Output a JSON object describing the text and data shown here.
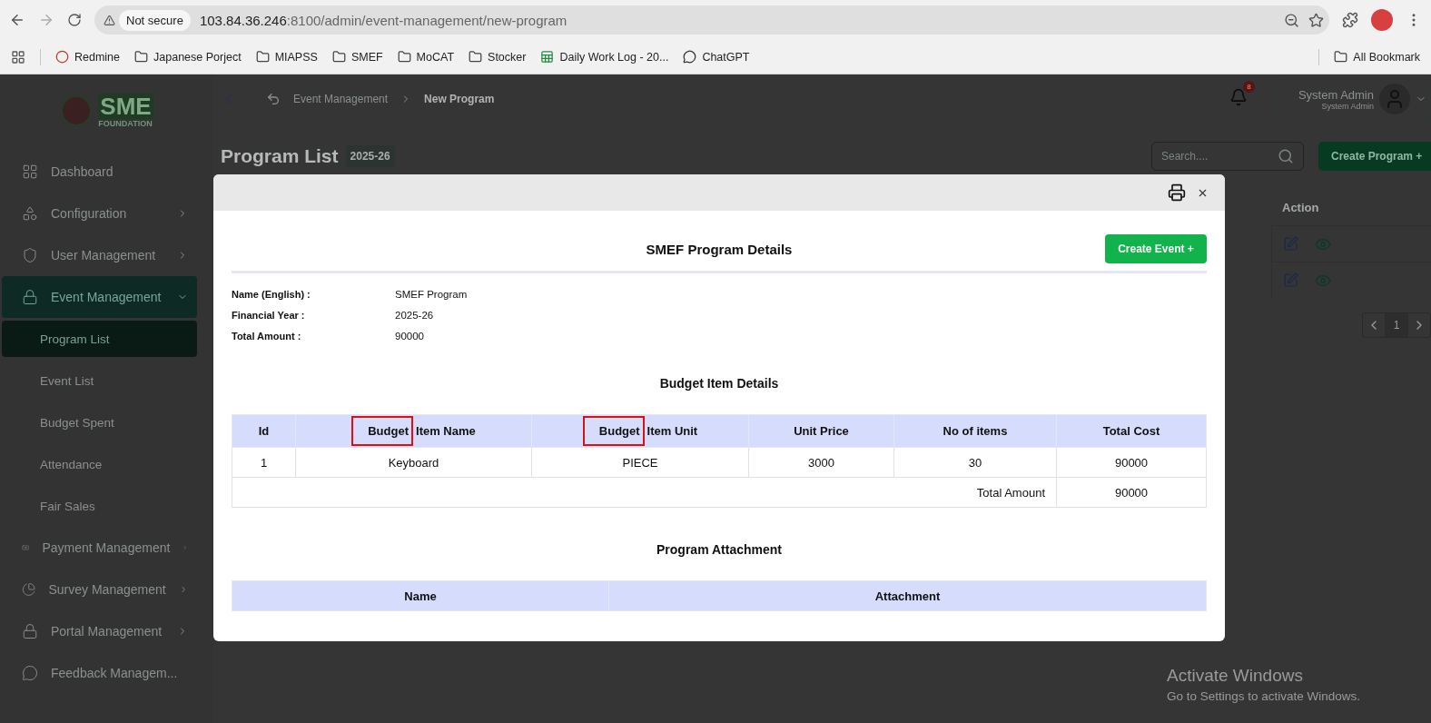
{
  "browser": {
    "security": "Not secure",
    "url_host": "103.84.36.246",
    "url_rest": ":8100/admin/event-management/new-program",
    "bookmarks": [
      {
        "label": "Redmine",
        "kind": "site"
      },
      {
        "label": "Japanese Porject",
        "kind": "folder"
      },
      {
        "label": "MIAPSS",
        "kind": "folder"
      },
      {
        "label": "SMEF",
        "kind": "folder"
      },
      {
        "label": "MoCAT",
        "kind": "folder"
      },
      {
        "label": "Stocker",
        "kind": "folder"
      },
      {
        "label": "Daily Work Log - 20...",
        "kind": "sheet"
      },
      {
        "label": "ChatGPT",
        "kind": "chat"
      }
    ],
    "all_bookmarks": "All Bookmark"
  },
  "sidebar": {
    "logo": {
      "mark": "SME",
      "caption": "FOUNDATION"
    },
    "items": [
      {
        "label": "Dashboard",
        "selected": false
      },
      {
        "label": "Configuration",
        "expanded": false,
        "selected": false
      },
      {
        "label": "User Management",
        "expanded": false,
        "selected": false
      },
      {
        "label": "Event Management",
        "expanded": true,
        "selected": true,
        "children": [
          {
            "label": "Program List",
            "selected": true
          },
          {
            "label": "Event List",
            "selected": false
          },
          {
            "label": "Budget Spent",
            "selected": false
          },
          {
            "label": "Attendance",
            "selected": false
          },
          {
            "label": "Fair Sales",
            "selected": false
          }
        ]
      },
      {
        "label": "Payment Management",
        "expanded": false,
        "selected": false
      },
      {
        "label": "Survey Management",
        "expanded": false,
        "selected": false
      },
      {
        "label": "Portal Management",
        "expanded": false,
        "selected": false
      },
      {
        "label": "Feedback Managem...",
        "selected": false
      }
    ]
  },
  "header": {
    "breadcrumb": [
      "Event Management",
      "New Program"
    ],
    "notification_count": "8",
    "user": {
      "name": "System Admin",
      "role": "System Admin"
    }
  },
  "page": {
    "title": "Program List",
    "year": "2025-26",
    "search": {
      "placeholder": "Search...."
    },
    "create_button": "Create Program +",
    "table": {
      "columns": [
        "Action"
      ],
      "rows": [
        {
          "kind": "actions"
        },
        {
          "kind": "actions"
        }
      ]
    },
    "pagination": {
      "page": "1"
    }
  },
  "modal": {
    "title": "SMEF Program Details",
    "create_button": "Create Event +",
    "fields": [
      {
        "label": "Name (English) :",
        "value": "SMEF Program"
      },
      {
        "label": "Financial Year :",
        "value": "2025-26"
      },
      {
        "label": "Total Amount :",
        "value": "90000"
      }
    ],
    "budget": {
      "title": "Budget Item Details",
      "columns": [
        {
          "text": "Id"
        },
        {
          "marked_text": "Budget",
          "text": "Item Name"
        },
        {
          "marked_text": "Budget",
          "text": "Item Unit"
        },
        {
          "text": "Unit Price"
        },
        {
          "text": "No of items"
        },
        {
          "text": "Total Cost"
        }
      ],
      "rows": [
        {
          "cells": [
            "1",
            "Keyboard",
            "PIECE",
            "3000",
            "30",
            "90000"
          ]
        }
      ],
      "total": {
        "label": "Total Amount",
        "value": "90000"
      }
    },
    "attachment": {
      "title": "Program Attachment",
      "columns": [
        {
          "text": "Name"
        },
        {
          "text": "Attachment"
        }
      ]
    }
  },
  "os_notice": {
    "title": "Activate Windows",
    "subtitle": "Go to Settings to activate Windows."
  }
}
